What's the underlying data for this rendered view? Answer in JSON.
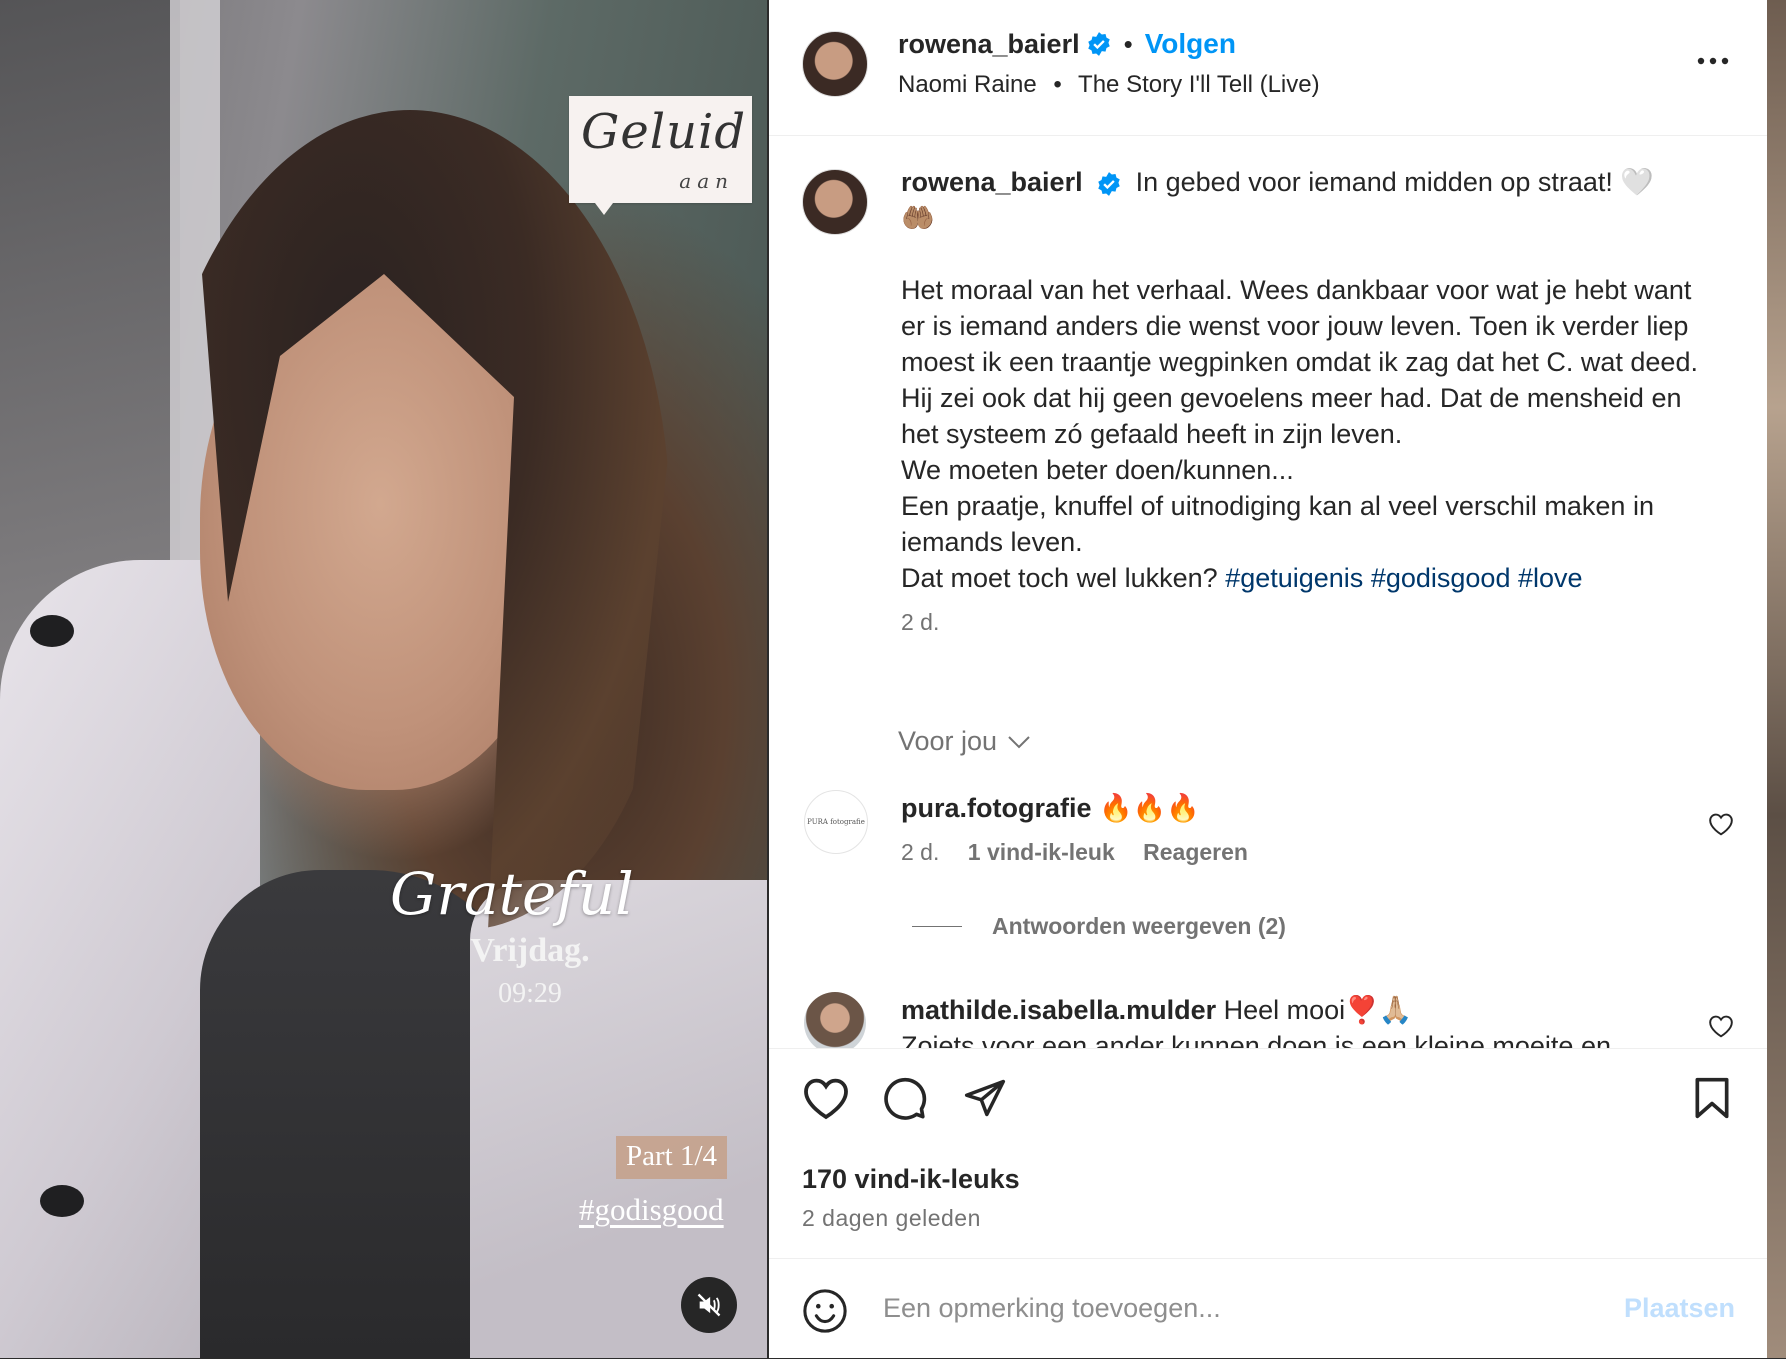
{
  "media": {
    "sticker_title": "Geluid",
    "sticker_sub": "aan",
    "script_text": "Grateful",
    "day": "Vrijdag.",
    "time": "09:29",
    "part": "Part 1/4",
    "hashtag": "#godisgood"
  },
  "header": {
    "username": "rowena_baierl",
    "follow_label": "Volgen",
    "music_artist": "Naomi Raine",
    "music_song": "The Story I'll Tell (Live)"
  },
  "caption": {
    "username": "rowena_baierl",
    "first_line": "In gebed voor iemand midden op straat! 🤍",
    "emoji_line": "🤲🏽",
    "body": [
      "Het moraal van het verhaal. Wees dankbaar voor wat je hebt want er is iemand anders die wenst voor jouw leven. Toen ik verder liep moest ik een traantje wegpinken omdat ik zag dat het C. wat deed. Hij zei ook dat hij geen gevoelens meer had. Dat de mensheid en het systeem zó gefaald heeft in zijn leven.",
      "We moeten beter doen/kunnen...",
      "Een praatje, knuffel of uitnodiging kan al veel verschil maken in iemands leven."
    ],
    "last_line": "Dat moet toch wel lukken?",
    "hashtags": [
      "#getuigenis",
      "#godisgood",
      "#love"
    ],
    "time": "2 d."
  },
  "sort_label": "Voor jou",
  "comments": [
    {
      "username": "pura.fotografie",
      "text": "🔥🔥🔥",
      "avatar_text": "PURA fotografie",
      "time": "2 d.",
      "likes": "1 vind-ik-leuk",
      "reply": "Reageren"
    },
    {
      "username": "mathilde.isabella.mulder",
      "text": "Heel mooi❣️🙏🏼",
      "text2": "Zoiets voor een ander kunnen doen is een kleine moeite en"
    }
  ],
  "view_replies": "Antwoorden weergeven (2)",
  "likes_count": "170 vind-ik-leuks",
  "posted_ago": "2 dagen geleden",
  "add_comment": {
    "placeholder": "Een opmerking toevoegen...",
    "post_label": "Plaatsen"
  },
  "colors": {
    "accent": "#0095f6",
    "hashtag": "#00376b",
    "muted": "#737373"
  }
}
